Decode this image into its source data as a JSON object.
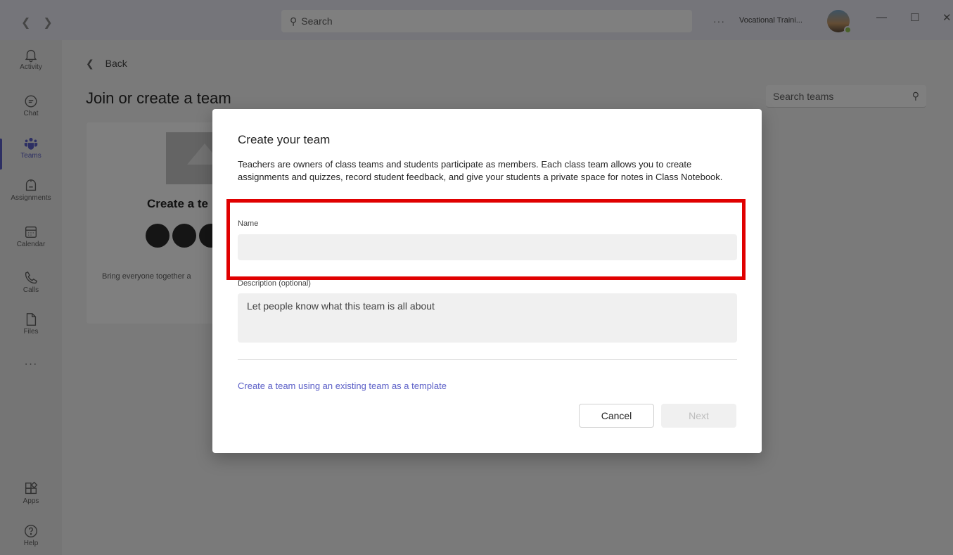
{
  "titlebar": {
    "search_placeholder": "Search",
    "more": "···",
    "org_name": "Vocational Traini..."
  },
  "rail": {
    "items": [
      {
        "label": "Activity",
        "icon": "bell-icon"
      },
      {
        "label": "Chat",
        "icon": "chat-icon"
      },
      {
        "label": "Teams",
        "icon": "teams-icon",
        "active": true
      },
      {
        "label": "Assignments",
        "icon": "assignments-icon"
      },
      {
        "label": "Calendar",
        "icon": "calendar-icon"
      },
      {
        "label": "Calls",
        "icon": "phone-icon"
      },
      {
        "label": "Files",
        "icon": "file-icon"
      }
    ],
    "more": "···",
    "bottom": [
      {
        "label": "Apps",
        "icon": "apps-icon"
      },
      {
        "label": "Help",
        "icon": "help-icon"
      }
    ]
  },
  "main": {
    "back_label": "Back",
    "title": "Join or create a team",
    "search_teams_placeholder": "Search teams",
    "card": {
      "title": "Create a te",
      "description": "Bring everyone together a"
    }
  },
  "dialog": {
    "title": "Create your team",
    "intro": "Teachers are owners of class teams and students participate as members. Each class team allows you to create assignments and quizzes, record student feedback, and give your students a private space for notes in Class Notebook.",
    "name_label": "Name",
    "name_value": "",
    "description_label": "Description (optional)",
    "description_placeholder": "Let people know what this team is all about",
    "template_link": "Create a team using an existing team as a template",
    "cancel_label": "Cancel",
    "next_label": "Next"
  },
  "colors": {
    "accent": "#5b5fc7",
    "highlight": "#e00000",
    "presence": "#92c353"
  }
}
